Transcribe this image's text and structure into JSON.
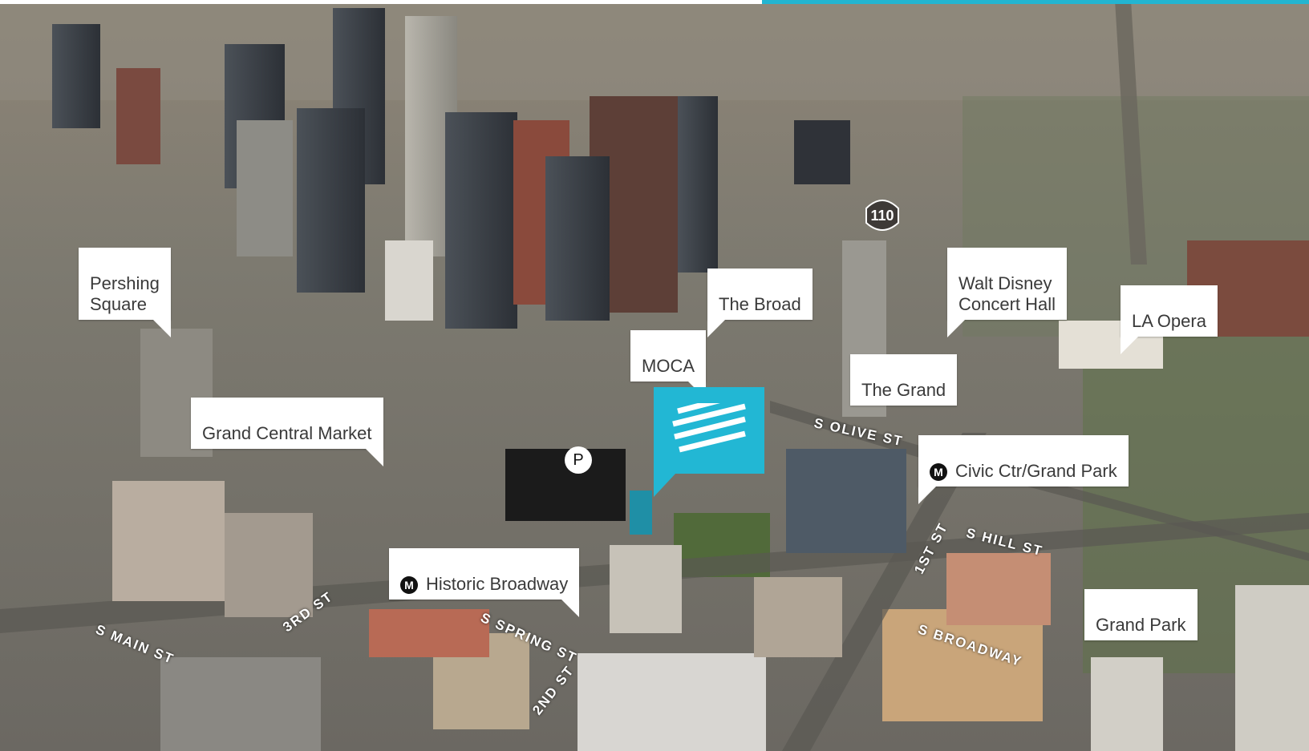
{
  "labels": {
    "pershing_square": "Pershing\nSquare",
    "the_broad": "The Broad",
    "walt_disney": "Walt Disney\nConcert Hall",
    "la_opera": "LA Opera",
    "moca": "MOCA",
    "the_grand": "The Grand",
    "grand_central_market": "Grand Central Market",
    "civic_center": "Civic Ctr/Grand Park",
    "historic_broadway": "Historic Broadway",
    "grand_park": "Grand Park"
  },
  "streets": {
    "s_olive": "S OLIVE ST",
    "s_hill": "S HILL ST",
    "first": "1ST ST",
    "s_broadway": "S BROADWAY",
    "s_main": "S MAIN ST",
    "third": "3RD ST",
    "s_spring": "S SPRING ST",
    "second": "2ND ST"
  },
  "markers": {
    "metro_symbol": "M",
    "parking_symbol": "P",
    "highway_shield": "110"
  },
  "colors": {
    "accent": "#22b7d4",
    "label_bg": "#ffffff",
    "label_text": "#3a3a3a"
  }
}
